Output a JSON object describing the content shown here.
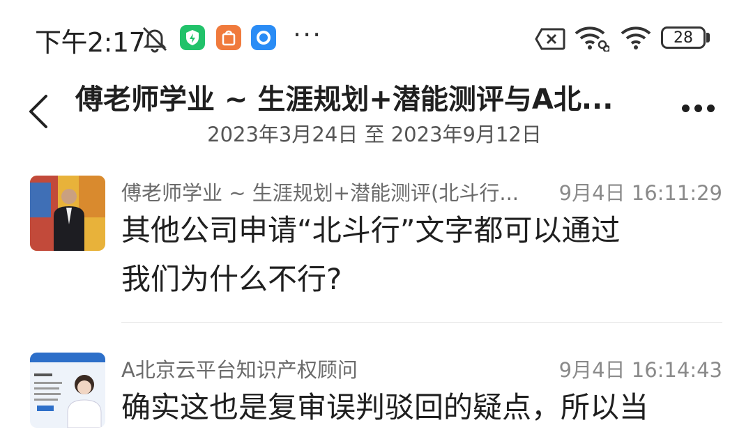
{
  "status_bar": {
    "time": "下午2:17",
    "battery": "28",
    "icons": [
      "dnd-icon",
      "green-app-icon",
      "orange-app-icon",
      "blue-app-icon",
      "more-dots-icon",
      "sim-x-icon",
      "wifi-link-icon",
      "wifi-icon",
      "battery-icon"
    ],
    "more": "···"
  },
  "header": {
    "title": "傅老师学业 ~ 生涯规划+潜能测评与A北...",
    "subtitle": "2023年3月24日 至 2023年9月12日"
  },
  "messages": [
    {
      "sender": "傅老师学业 ~ 生涯规划+潜能测评(北斗行...",
      "time": "9月4日 16:11:29",
      "lines": [
        "其他公司申请“北斗行”文字都可以通过",
        "我们为什么不行?"
      ]
    },
    {
      "sender": "A北京云平台知识产权顾问",
      "time": "9月4日 16:14:43",
      "lines": [
        "确实这也是复审误判驳回的疑点，所以当"
      ]
    }
  ],
  "colors": {
    "green_app": "#21c26a",
    "orange_app": "#f07a3c",
    "blue_app": "#2a8cf5"
  }
}
